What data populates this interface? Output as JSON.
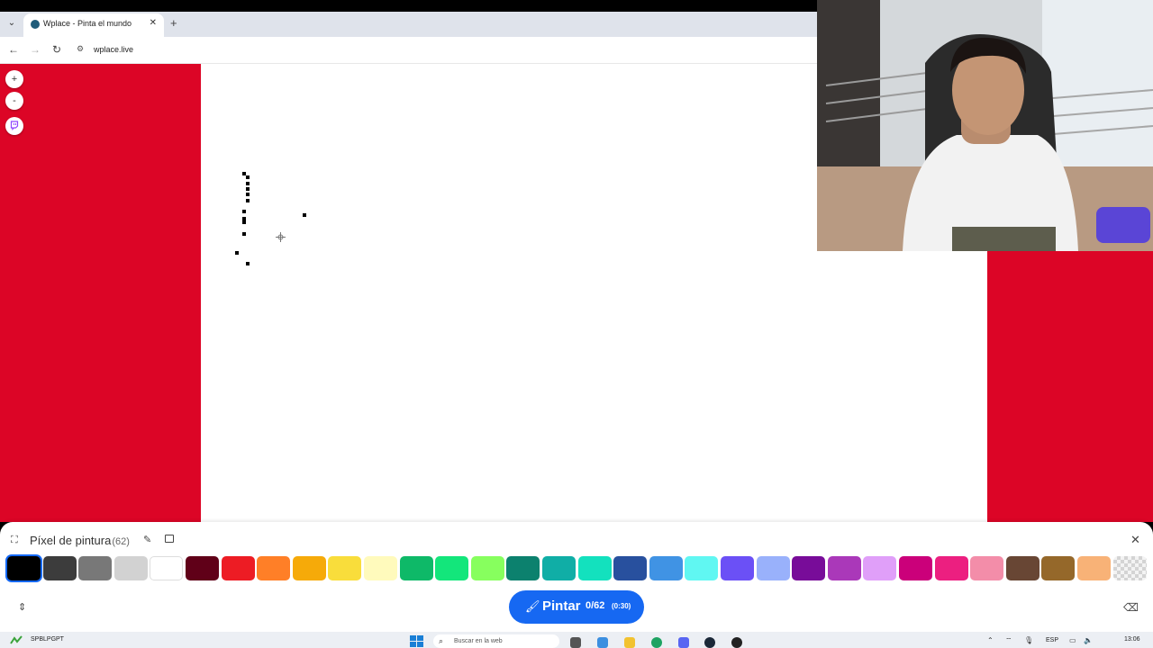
{
  "browser": {
    "tab_title": "Wplace - Pinta el mundo",
    "url": "wplace.live",
    "icons": {
      "tab_menu": "chevron-down-icon",
      "close": "close-icon",
      "new_tab": "plus-icon",
      "back": "back-arrow-icon",
      "forward": "forward-arrow-icon",
      "reload": "reload-icon",
      "site_info": "site-info-icon"
    },
    "glyphs": {
      "tab_menu": "⌄",
      "close": "✕",
      "new_tab": "+",
      "back": "←",
      "forward": "→",
      "reload": "↻",
      "site_info": "⚙"
    }
  },
  "map_controls": {
    "zoom_in": "+",
    "zoom_out": "-",
    "icons": {
      "zoom_in": "plus-icon",
      "zoom_out": "minus-icon",
      "twitch": "twitch-icon"
    }
  },
  "colors": {
    "page_red": "#dc0526",
    "accent_blue": "#1668f2"
  },
  "panel": {
    "title": "Píxel de pintura",
    "count": "(62)",
    "palette": [
      "#000000",
      "#3c3c3c",
      "#787878",
      "#d2d2d2",
      "#ffffff",
      "#600018",
      "#ed1c24",
      "#ff7f27",
      "#f6aa09",
      "#f9dd3b",
      "#fffabc",
      "#0eb968",
      "#13e67b",
      "#87ff5e",
      "#0c816e",
      "#10aea6",
      "#13e1be",
      "#28509e",
      "#4093e4",
      "#60f7f2",
      "#6b50f6",
      "#99b1fb",
      "#780c99",
      "#aa38b9",
      "#e09ff9",
      "#cb007a",
      "#ec1f80",
      "#f38da9",
      "#684634",
      "#95682a",
      "#f8b277",
      "transparent"
    ],
    "selected_index": 0,
    "paint_button": {
      "label": "Pintar",
      "count": "0/62",
      "timer": "(0:30)"
    },
    "icons": {
      "collapse": "fullscreen-icon",
      "edit": "pencil-icon",
      "mode": "window-icon",
      "close": "close-icon",
      "paint": "brush-icon",
      "expand": "expand-arrows-icon",
      "eraser": "eraser-icon"
    },
    "glyphs": {
      "collapse": "⛶",
      "edit": "✎",
      "close": "✕",
      "paint": "🖌",
      "expand": "⇕",
      "eraser": "⌫"
    }
  },
  "taskbar": {
    "weather_label": "SPBLPGPT",
    "search_placeholder": "Buscar en la web",
    "language": "ESP",
    "clock": "13:06",
    "icons": {
      "search": "search-icon",
      "start": "windows-start-icon"
    },
    "glyphs": {
      "search": "⌕",
      "tray_up": "⌃",
      "wifi": "⌔",
      "volume": "🔈",
      "mic": "🎙",
      "display": "▭"
    }
  }
}
